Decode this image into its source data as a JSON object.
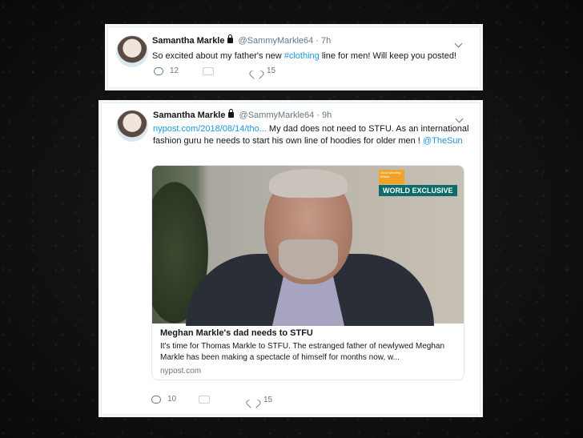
{
  "tweet1": {
    "name": "Samantha Markle",
    "handle": "@SammyMarkle64",
    "separator": "·",
    "time": "7h",
    "text_before": "So excited about my father's new ",
    "hashtag": "#clothing",
    "text_after": " line for men!  Will keep you posted!",
    "replies": "12",
    "likes": "15"
  },
  "tweet2": {
    "name": "Samantha Markle",
    "handle": "@SammyMarkle64",
    "separator": "·",
    "time": "9h",
    "url": "nypost.com/2018/08/14/tho...",
    "text": "   My dad does not need to STFU.  As an international fashion guru he needs to start his own line of hoodies for older men ! ",
    "mention": "@TheSun",
    "card": {
      "badge": "WORLD EXCLUSIVE",
      "overlay_logo": "Good Morning Britain",
      "title": "Meghan Markle's dad needs to STFU",
      "description": "It's time for Thomas Markle to STFU. The estranged father of newlywed Meghan Markle has been making a spectacle of himself for months now, w...",
      "source": "nypost.com"
    },
    "replies": "10",
    "likes": "15"
  },
  "icons": {
    "avatar": "profile-photo",
    "lock": "lock-icon",
    "caret": "chevron-down-icon",
    "reply": "reply-icon",
    "retweet": "retweet-icon",
    "like": "heart-icon"
  },
  "colors": {
    "link": "#1b95e0",
    "muted": "#657786",
    "text": "#14171a",
    "badge": "#0d6b69"
  }
}
